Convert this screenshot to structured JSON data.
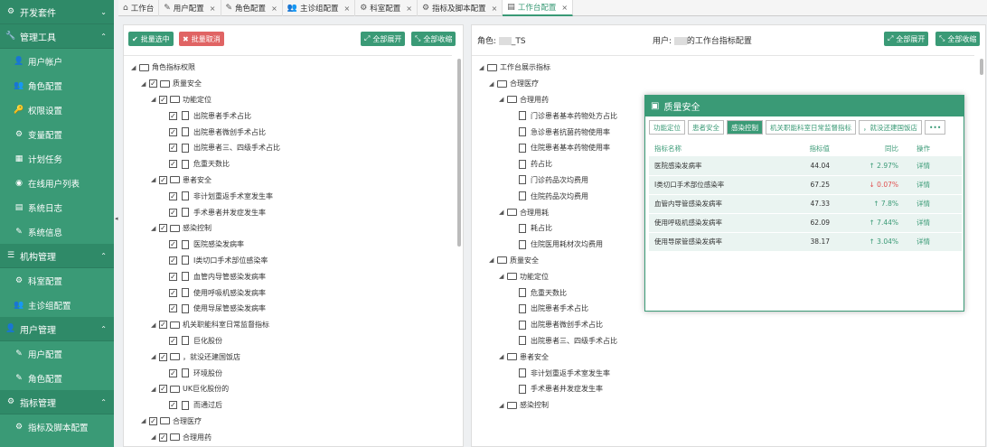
{
  "sidebar": {
    "s0": "开发套件",
    "s1": "管理工具",
    "i1a": "用户帐户",
    "i1b": "角色配置",
    "i1c": "权限设置",
    "i1d": "变量配置",
    "i1e": "计划任务",
    "i1f": "在线用户列表",
    "i1g": "系统日志",
    "i1h": "系统信息",
    "s2": "机构管理",
    "i2a": "科室配置",
    "i2b": "主诊组配置",
    "s3": "用户管理",
    "i3a": "用户配置",
    "i3b": "角色配置",
    "s4": "指标管理",
    "i4a": "指标及脚本配置"
  },
  "tabs": [
    "工作台",
    "用户配置",
    "角色配置",
    "主诊组配置",
    "科室配置",
    "指标及脚本配置",
    "工作台配置"
  ],
  "left": {
    "btn_select": "批量选中",
    "btn_cancel": "批量取消",
    "btn_expand": "全部展开",
    "btn_collapse": "全部收缩",
    "tree": [
      "角色指标权限",
      "质量安全",
      "功能定位",
      "出院患者手术占比",
      "出院患者微创手术占比",
      "出院患者三、四级手术占比",
      "危重天数比",
      "患者安全",
      "非计划重返手术室发生率",
      "手术患者并发症发生率",
      "感染控制",
      "医院感染发病率",
      "I类切口手术部位感染率",
      "血管内导管感染发病率",
      "使用呼吸机感染发病率",
      "使用导尿管感染发病率",
      "机关职能科室日常监督指标",
      "巨化股份",
      "，就没还建国饭店",
      "环境股份",
      "UK巨化股份的",
      "而通过后",
      "合理医疗",
      "合理用药"
    ]
  },
  "right": {
    "role_label": "角色:",
    "role_value": "_TS",
    "user_label": "用户:",
    "user_value": "的工作台指标配置",
    "btn_expand": "全部展开",
    "btn_collapse": "全部收缩",
    "tree": [
      "工作台展示指标",
      "合理医疗",
      "合理用药",
      "门诊患者基本药物处方占比",
      "急诊患者抗菌药物使用率",
      "住院患者基本药物使用率",
      "药占比",
      "门诊药品次均费用",
      "住院药品次均费用",
      "合理用耗",
      "耗占比",
      "住院医用耗材次均费用",
      "质量安全",
      "功能定位",
      "危重天数比",
      "出院患者手术占比",
      "出院患者微创手术占比",
      "出院患者三、四级手术占比",
      "患者安全",
      "非计划重返手术室发生率",
      "手术患者并发症发生率",
      "感染控制"
    ]
  },
  "card": {
    "title": "质量安全",
    "tabs": [
      "功能定位",
      "患者安全",
      "感染控制",
      "机关职能科室日常监督指标",
      "，就没还建国饭店",
      "•••"
    ],
    "cols": [
      "指标名称",
      "指标值",
      "同比",
      "操作"
    ],
    "rows": [
      {
        "name": "医院感染发病率",
        "value": "44.04",
        "yoy": "↑ 2.97%",
        "dir": "up",
        "op": "详情"
      },
      {
        "name": "I类切口手术部位感染率",
        "value": "67.25",
        "yoy": "↓ 0.07%",
        "dir": "down",
        "op": "详情"
      },
      {
        "name": "血管内导管感染发病率",
        "value": "47.33",
        "yoy": "↑ 7.8%",
        "dir": "up",
        "op": "详情"
      },
      {
        "name": "使用呼吸机感染发病率",
        "value": "62.09",
        "yoy": "↑ 7.44%",
        "dir": "up",
        "op": "详情"
      },
      {
        "name": "使用导尿管感染发病率",
        "value": "38.17",
        "yoy": "↑ 3.04%",
        "dir": "up",
        "op": "详情"
      }
    ]
  },
  "colors": {
    "accent": "#3a9a76",
    "danger": "#e06464"
  }
}
